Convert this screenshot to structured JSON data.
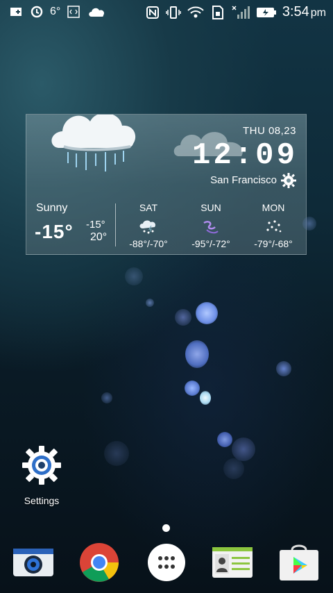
{
  "status_bar": {
    "temperature": "6°",
    "time": "3:54",
    "ampm": "pm",
    "icons_left": [
      "add-icon",
      "sync-icon",
      "temperature",
      "code-icon",
      "cloud-icon"
    ],
    "icons_right": [
      "nfc-icon",
      "vibrate-icon",
      "wifi-icon",
      "sim-icon",
      "signal-icon",
      "battery-charging-icon"
    ]
  },
  "weather_widget": {
    "date": "THU 08,23",
    "clock": "12:09",
    "city": "San Francisco",
    "condition": "Sunny",
    "current_temp": "-15°",
    "high": "-15°",
    "low": "20°",
    "forecast": [
      {
        "day": "SAT",
        "range": "-88°/-70°",
        "icon": "snow-cloud-icon"
      },
      {
        "day": "SUN",
        "range": "-95°/-72°",
        "icon": "wind-icon"
      },
      {
        "day": "MON",
        "range": "-79°/-68°",
        "icon": "snowflake-icon"
      }
    ]
  },
  "home": {
    "settings_label": "Settings"
  },
  "dock": {
    "apps": [
      "camera-icon",
      "chrome-icon",
      "app-drawer-icon",
      "contacts-icon",
      "play-store-icon"
    ]
  },
  "colors": {
    "background_top": "#123444",
    "background_bottom": "#071119",
    "bokeh": "#6d8fe6"
  }
}
